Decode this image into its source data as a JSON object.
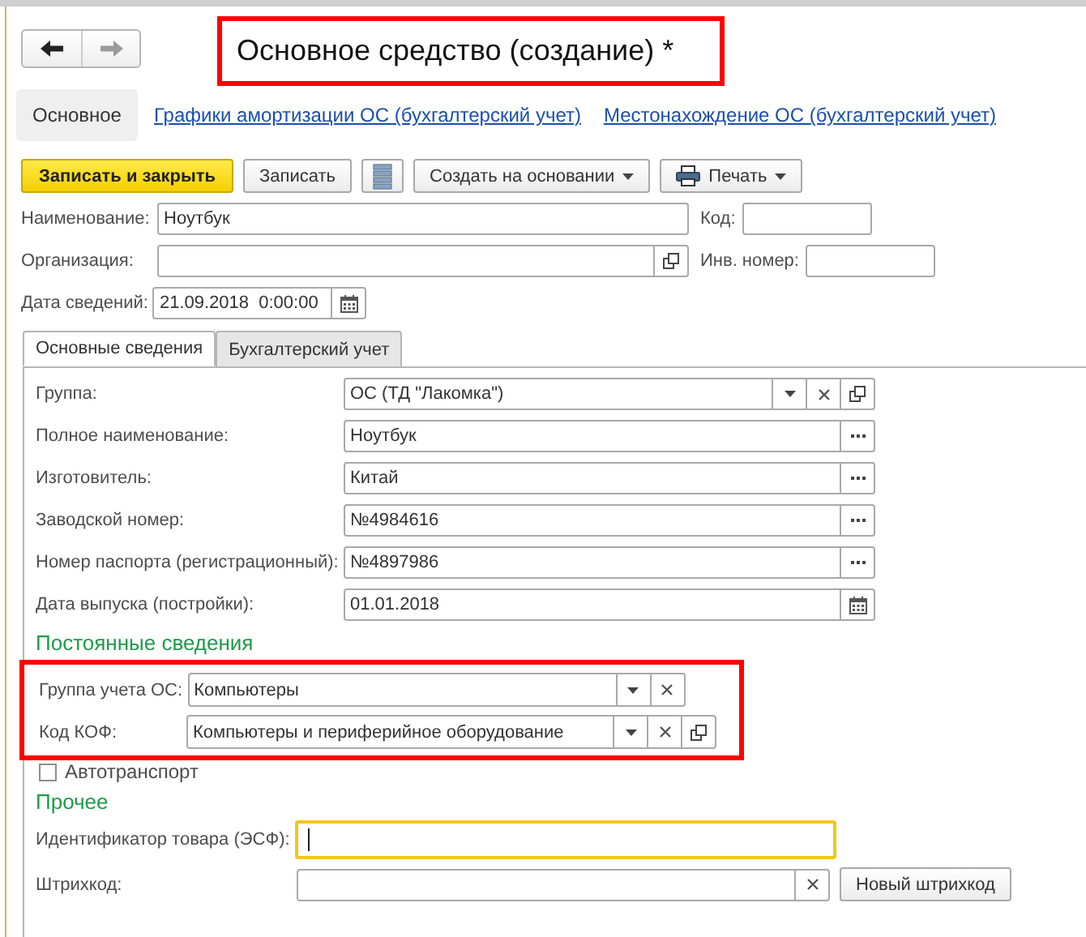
{
  "nav": [
    {
      "kind": "back",
      "disabled": false
    },
    {
      "kind": "forward",
      "disabled": true
    }
  ],
  "title": {
    "text": "Основное средство (создание) *",
    "highlighted": true
  },
  "panel_links": [
    {
      "label": "Основное",
      "selected": true
    },
    {
      "label": "Графики амортизации ОС (бухгалтерский учет)",
      "selected": false
    },
    {
      "label": "Местонахождение ОС (бухгалтерский учет)",
      "selected": false
    }
  ],
  "toolbar": [
    {
      "kind": "primary",
      "label": "Записать и закрыть"
    },
    {
      "kind": "button",
      "label": "Записать"
    },
    {
      "kind": "list"
    },
    {
      "kind": "menu",
      "label": "Создать на основании"
    },
    {
      "kind": "print",
      "label": "Печать"
    }
  ],
  "header_rows": [
    [
      {
        "label": "Наименование:",
        "value": "Ноутбук"
      },
      {
        "label": "Код:"
      }
    ],
    [
      {
        "label": "Организация:",
        "buttons": [
          {
            "kind": "open"
          }
        ]
      },
      {
        "label": "Инв. номер:"
      }
    ],
    [
      {
        "label": "Дата сведений:",
        "value": "21.09.2018  0:00:00",
        "buttons": [
          {
            "kind": "calendar"
          }
        ]
      }
    ]
  ],
  "tabs": [
    {
      "label": "Основные сведения",
      "selected": true
    },
    {
      "label": "Бухгалтерский учет",
      "selected": false
    }
  ],
  "fields": [
    {
      "label": "Группа:",
      "value": "ОС (ТД \"Лакомка\")",
      "buttons": [
        {
          "kind": "dropdown"
        },
        {
          "kind": "clear"
        },
        {
          "kind": "open"
        }
      ]
    },
    {
      "label": "Полное наименование:",
      "value": "Ноутбук",
      "buttons": [
        {
          "kind": "select"
        }
      ]
    },
    {
      "label": "Изготовитель:",
      "value": "Китай",
      "buttons": [
        {
          "kind": "select"
        }
      ]
    },
    {
      "label": "Заводской номер:",
      "value": "№4984616",
      "buttons": [
        {
          "kind": "select"
        }
      ]
    },
    {
      "label": "Номер паспорта (регистрационный):",
      "value": "№4897986",
      "buttons": [
        {
          "kind": "select"
        }
      ]
    },
    {
      "label": "Дата выпуска (постройки):",
      "value": "01.01.2018",
      "buttons": [
        {
          "kind": "calendar"
        }
      ]
    }
  ],
  "fixed_section": {
    "title": "Постоянные сведения",
    "highlighted": true,
    "fields": [
      {
        "label": "Группа учета ОС:",
        "value": "Компьютеры",
        "buttons": [
          {
            "kind": "dropdown"
          },
          {
            "kind": "clear"
          }
        ]
      },
      {
        "label": "Код КОФ:",
        "value": "Компьютеры и периферийное оборудование",
        "buttons": [
          {
            "kind": "dropdown"
          },
          {
            "kind": "clear"
          },
          {
            "kind": "open"
          }
        ]
      }
    ]
  },
  "checkbox": {
    "label": "Автотранспорт",
    "checked": false
  },
  "other_section": {
    "title": "Прочее",
    "fields": [
      {
        "label": "Идентификатор товара (ЭСФ):",
        "focused": true
      },
      {
        "label": "Штрихкод:",
        "focused": false,
        "buttons": [
          {
            "kind": "clear"
          }
        ],
        "action": "Новый штрихкод"
      }
    ]
  }
}
